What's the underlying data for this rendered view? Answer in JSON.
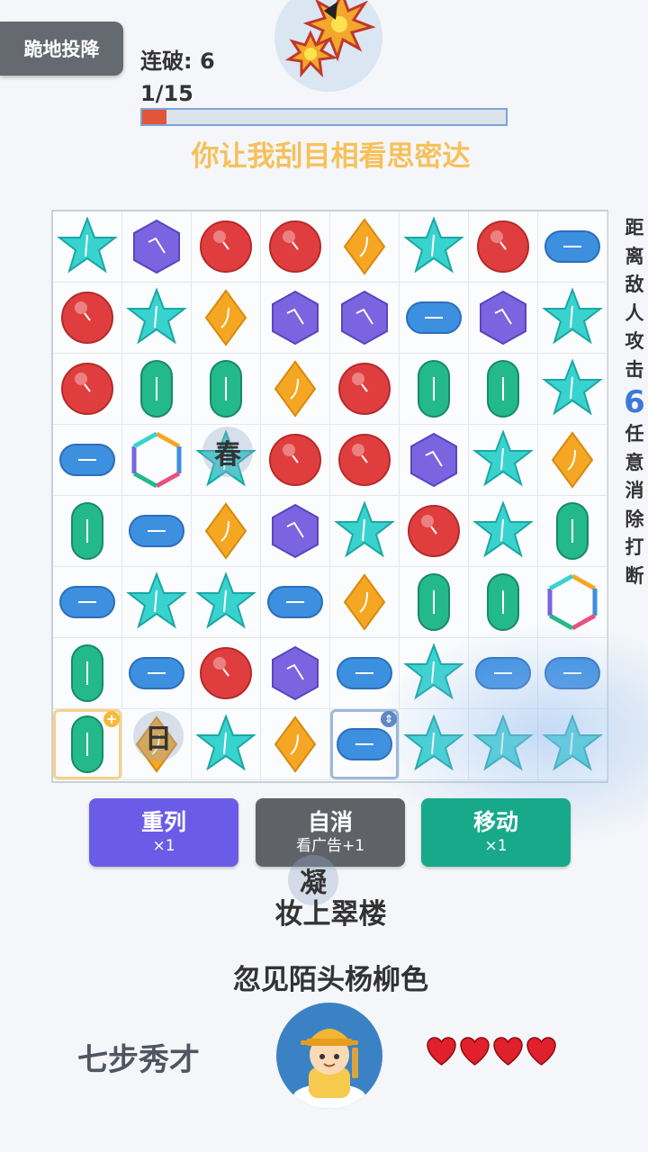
{
  "header": {
    "surrender_label": "跪地投降",
    "combo_text": "连破: 6",
    "progress_text": "1/15",
    "progress_fraction": 0.067,
    "poem_line": "你让我刮目相看思密达"
  },
  "enemy": {
    "avatar_icon": "explosion-icon"
  },
  "board": {
    "rows": 8,
    "cols": 8,
    "grid": [
      [
        "star",
        "hexagon",
        "ball",
        "ball",
        "diamond",
        "star",
        "ball",
        "capsule-h"
      ],
      [
        "ball",
        "star",
        "diamond",
        "hexagon",
        "hexagon",
        "capsule-h",
        "hexagon",
        "star"
      ],
      [
        "ball",
        "capsule-v",
        "capsule-v",
        "diamond",
        "ball",
        "capsule-v",
        "capsule-v",
        "star"
      ],
      [
        "capsule-h",
        "rainbow-hexagon",
        "star",
        "ball",
        "ball",
        "hexagon",
        "star",
        "diamond"
      ],
      [
        "capsule-v",
        "capsule-h",
        "diamond",
        "hexagon",
        "star",
        "ball",
        "star",
        "capsule-v"
      ],
      [
        "capsule-h",
        "star",
        "star",
        "capsule-h",
        "diamond",
        "capsule-v",
        "capsule-v",
        "rainbow-hexagon"
      ],
      [
        "capsule-v",
        "capsule-h",
        "ball",
        "hexagon",
        "capsule-h",
        "star",
        "capsule-h",
        "capsule-h"
      ],
      [
        "capsule-v",
        "diamond",
        "star",
        "diamond",
        "capsule-h",
        "star",
        "star",
        "star"
      ]
    ],
    "floating_chars": [
      {
        "char": "春",
        "row": 3,
        "col": 2
      },
      {
        "char": "日",
        "row": 7,
        "col": 1
      }
    ],
    "bonus_badge": "+",
    "move_badge": "⇕"
  },
  "side_text": {
    "top": [
      "距",
      "离",
      "敌",
      "人",
      "攻",
      "击"
    ],
    "number": "6",
    "bottom": [
      "任",
      "意",
      "消",
      "除",
      "打",
      "断"
    ]
  },
  "buttons": [
    {
      "label": "重列",
      "sub": "×1",
      "color": "#6b5ce7"
    },
    {
      "label": "自消",
      "sub": "看广告+1",
      "color": "#5f6368"
    },
    {
      "label": "移动",
      "sub": "×1",
      "color": "#17a98a"
    }
  ],
  "poem": {
    "floating_char": "凝",
    "line1": "妆上翠楼",
    "line2": "忽见陌头杨柳色"
  },
  "player": {
    "title": "七步秀才",
    "avatar_icon": "scholar-avatar-icon",
    "hearts": 4
  },
  "colors": {
    "star": "#39d3cf",
    "hexagon": "#7a64e0",
    "ball": "#e03e3e",
    "diamond": "#f5a623",
    "capsule-h": "#3d8fe0",
    "capsule-v": "#24b98a",
    "heart": "#e0202a"
  }
}
